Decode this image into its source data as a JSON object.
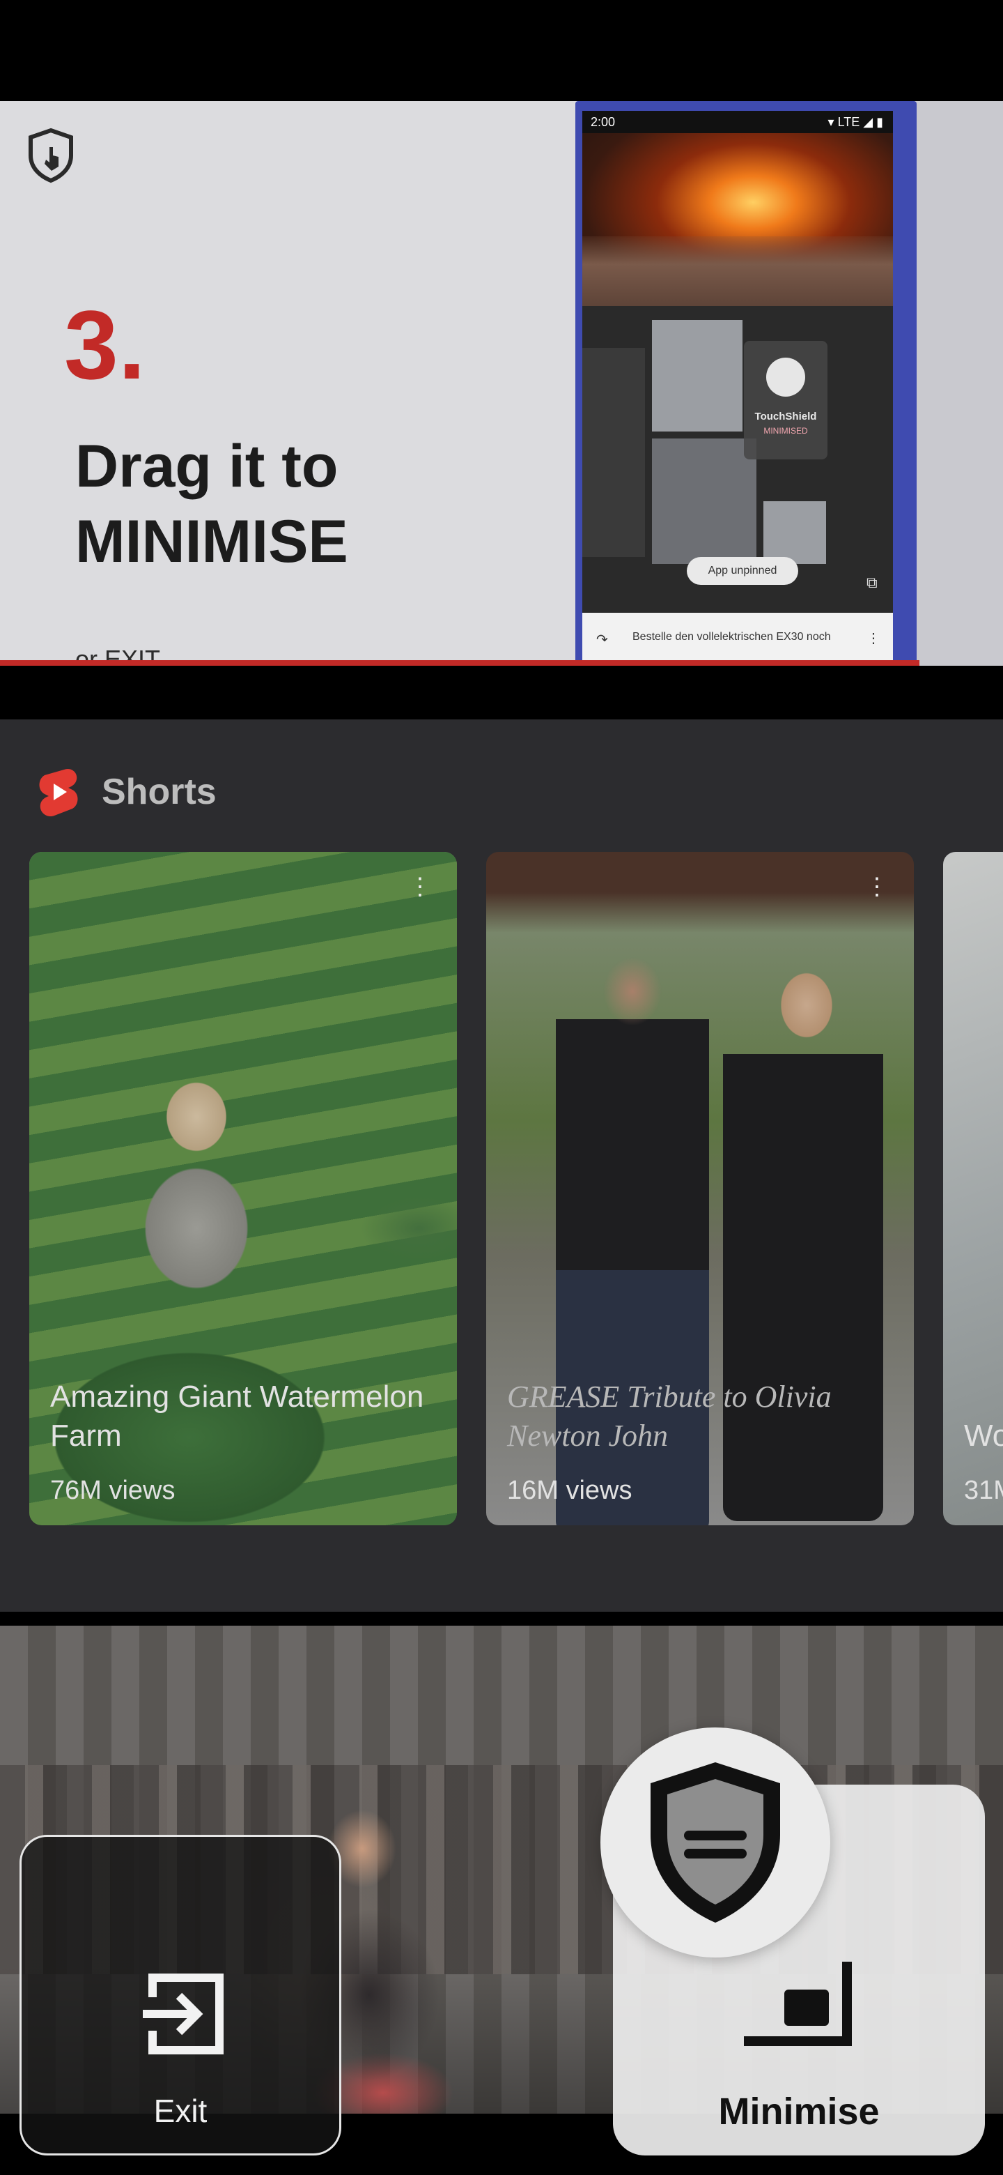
{
  "ad": {
    "step_number": "3.",
    "headline": "Drag it to MINIMISE",
    "subline": "or EXIT.",
    "phone": {
      "status_time": "2:00",
      "status_right": "▾ LTE ◢ ▮",
      "overlay_title": "TouchShield",
      "overlay_subtitle": "MINIMISED",
      "unpin_label": "App unpinned",
      "bottom_text": "Bestelle den vollelektrischen EX30 noch",
      "bottom_more": "⋮"
    }
  },
  "shorts": {
    "title": "Shorts",
    "items": [
      {
        "caption": "Amazing Giant Watermelon Farm",
        "views": "76M views",
        "more": "⋮"
      },
      {
        "caption": "GREASE  Tribute to Olivia Newton John",
        "views": "16M views",
        "more": "⋮"
      },
      {
        "caption": "Wo ch",
        "views": "31M"
      }
    ]
  },
  "overlay": {
    "exit_label": "Exit",
    "minimise_label": "Minimise"
  },
  "colors": {
    "accent_red": "#c22a27",
    "shorts_red": "#e23a32",
    "panel_dark": "#2c2c2f"
  }
}
